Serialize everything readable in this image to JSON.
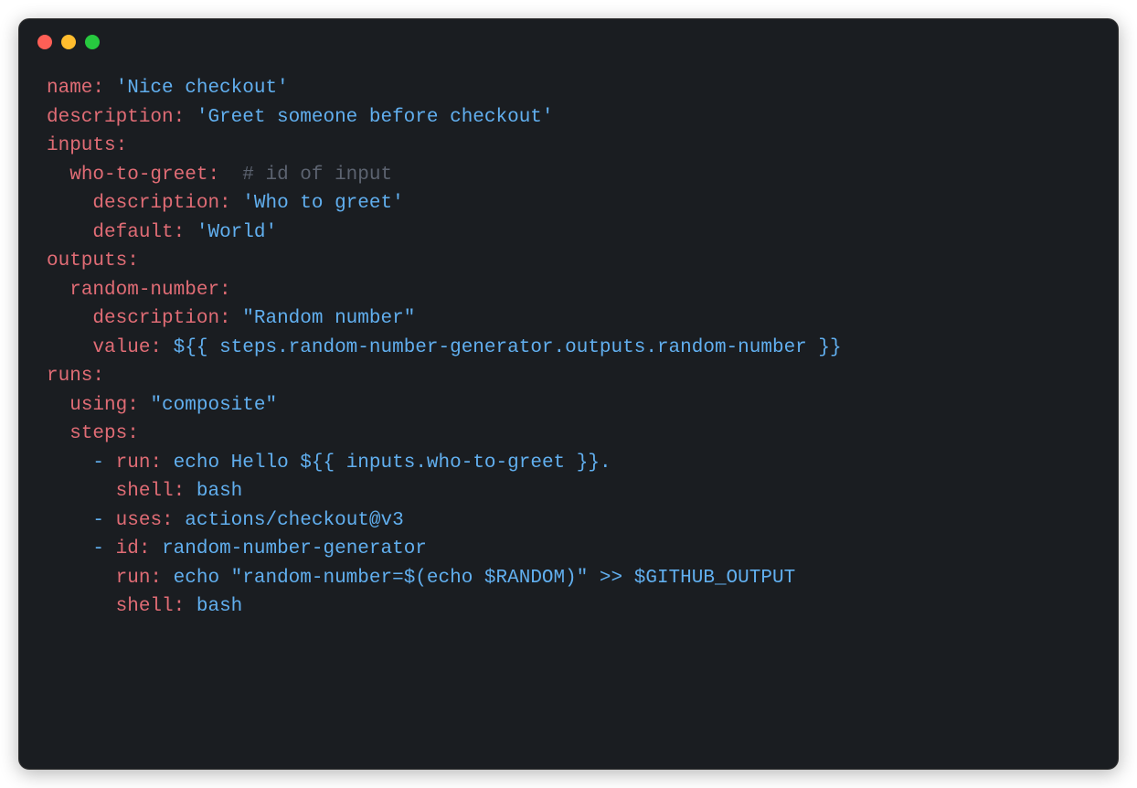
{
  "code": {
    "lines": [
      {
        "indent": 0,
        "parts": [
          {
            "type": "key",
            "text": "name:"
          },
          {
            "type": "default",
            "text": " "
          },
          {
            "type": "string",
            "text": "'Nice checkout'"
          }
        ]
      },
      {
        "indent": 0,
        "parts": [
          {
            "type": "key",
            "text": "description:"
          },
          {
            "type": "default",
            "text": " "
          },
          {
            "type": "string",
            "text": "'Greet someone before checkout'"
          }
        ]
      },
      {
        "indent": 0,
        "parts": [
          {
            "type": "key",
            "text": "inputs:"
          }
        ]
      },
      {
        "indent": 1,
        "parts": [
          {
            "type": "key",
            "text": "who-to-greet:"
          },
          {
            "type": "default",
            "text": "  "
          },
          {
            "type": "comment",
            "text": "# id of input"
          }
        ]
      },
      {
        "indent": 2,
        "parts": [
          {
            "type": "key",
            "text": "description:"
          },
          {
            "type": "default",
            "text": " "
          },
          {
            "type": "string",
            "text": "'Who to greet'"
          }
        ]
      },
      {
        "indent": 2,
        "parts": [
          {
            "type": "key",
            "text": "default:"
          },
          {
            "type": "default",
            "text": " "
          },
          {
            "type": "string",
            "text": "'World'"
          }
        ]
      },
      {
        "indent": 0,
        "parts": [
          {
            "type": "key",
            "text": "outputs:"
          }
        ]
      },
      {
        "indent": 1,
        "parts": [
          {
            "type": "key",
            "text": "random-number:"
          }
        ]
      },
      {
        "indent": 2,
        "parts": [
          {
            "type": "key",
            "text": "description:"
          },
          {
            "type": "default",
            "text": " "
          },
          {
            "type": "string",
            "text": "\"Random number\""
          }
        ]
      },
      {
        "indent": 2,
        "parts": [
          {
            "type": "key",
            "text": "value:"
          },
          {
            "type": "default",
            "text": " "
          },
          {
            "type": "string",
            "text": "${{ steps.random-number-generator.outputs.random-number }}"
          }
        ]
      },
      {
        "indent": 0,
        "parts": [
          {
            "type": "key",
            "text": "runs:"
          }
        ]
      },
      {
        "indent": 1,
        "parts": [
          {
            "type": "key",
            "text": "using:"
          },
          {
            "type": "default",
            "text": " "
          },
          {
            "type": "string",
            "text": "\"composite\""
          }
        ]
      },
      {
        "indent": 1,
        "parts": [
          {
            "type": "key",
            "text": "steps:"
          }
        ]
      },
      {
        "indent": 2,
        "parts": [
          {
            "type": "dash",
            "text": "- "
          },
          {
            "type": "key",
            "text": "run:"
          },
          {
            "type": "default",
            "text": " "
          },
          {
            "type": "string",
            "text": "echo Hello ${{ inputs.who-to-greet }}."
          }
        ]
      },
      {
        "indent": 3,
        "parts": [
          {
            "type": "key",
            "text": "shell:"
          },
          {
            "type": "default",
            "text": " "
          },
          {
            "type": "string",
            "text": "bash"
          }
        ]
      },
      {
        "indent": 2,
        "parts": [
          {
            "type": "dash",
            "text": "- "
          },
          {
            "type": "key",
            "text": "uses:"
          },
          {
            "type": "default",
            "text": " "
          },
          {
            "type": "string",
            "text": "actions/checkout@v3"
          }
        ]
      },
      {
        "indent": 2,
        "parts": [
          {
            "type": "dash",
            "text": "- "
          },
          {
            "type": "key",
            "text": "id:"
          },
          {
            "type": "default",
            "text": " "
          },
          {
            "type": "string",
            "text": "random-number-generator"
          }
        ]
      },
      {
        "indent": 3,
        "parts": [
          {
            "type": "key",
            "text": "run:"
          },
          {
            "type": "default",
            "text": " "
          },
          {
            "type": "string",
            "text": "echo \"random-number=$(echo $RANDOM)\" >> $GITHUB_OUTPUT"
          }
        ]
      },
      {
        "indent": 3,
        "parts": [
          {
            "type": "key",
            "text": "shell:"
          },
          {
            "type": "default",
            "text": " "
          },
          {
            "type": "string",
            "text": "bash"
          }
        ]
      }
    ]
  }
}
